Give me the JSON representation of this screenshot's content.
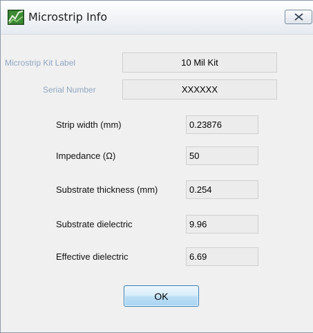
{
  "window": {
    "title": "Microstrip Info",
    "icon": "app-chart-icon",
    "close_icon": "close-x-icon"
  },
  "header_fields": [
    {
      "label": "Microstrip Kit Label",
      "value": "10 Mil Kit"
    },
    {
      "label": "Serial Number",
      "value": "XXXXXX"
    }
  ],
  "fields": [
    {
      "label": "Strip width (mm)",
      "value": "0.23876"
    },
    {
      "label": "Impedance (Ω)",
      "value": "50"
    },
    {
      "label": "Substrate thickness (mm)",
      "value": "0.254"
    },
    {
      "label": "Substrate dielectric",
      "value": "9.96"
    },
    {
      "label": "Effective dielectric",
      "value": "6.69"
    }
  ],
  "buttons": {
    "ok_label": "OK"
  },
  "colors": {
    "window_bg": "#f0f0f0",
    "disabled_label": "#8fa7c2",
    "button_border": "#3c7fb1"
  }
}
